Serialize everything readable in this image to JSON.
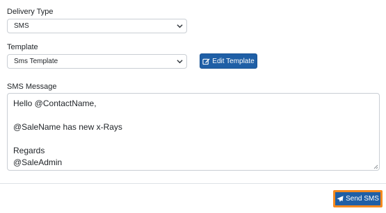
{
  "delivery_type": {
    "label": "Delivery Type",
    "selected": "SMS"
  },
  "template": {
    "label": "Template",
    "selected": "Sms Template",
    "edit_button_label": "Edit Template"
  },
  "sms_message": {
    "label": "SMS Message",
    "value": "Hello @ContactName,\n\n@SaleName has new x-Rays\n\nRegards\n@SaleAdmin"
  },
  "footer": {
    "send_button_label": "Send SMS"
  },
  "colors": {
    "primary_button": "#1f5fa6",
    "focus_outline": "#f58a1f"
  }
}
